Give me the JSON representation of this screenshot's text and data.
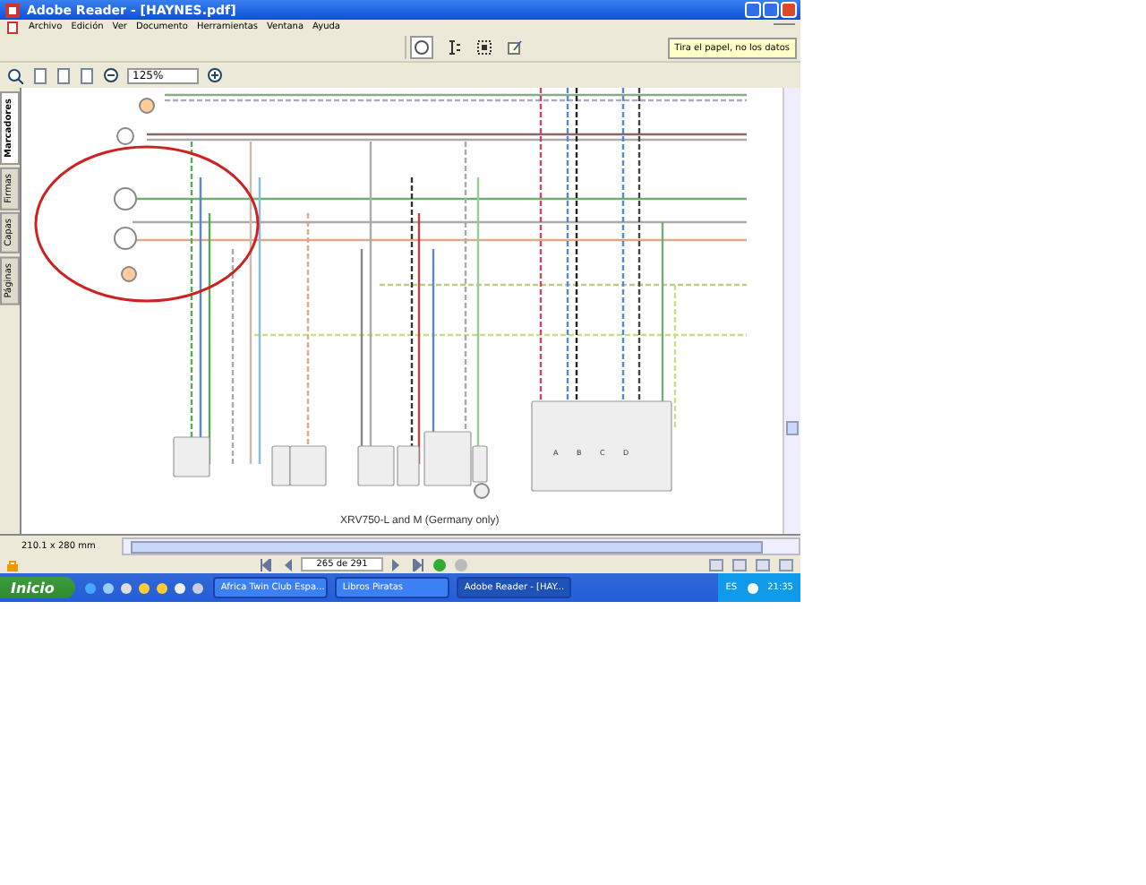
{
  "window": {
    "title": "Adobe Reader - [HAYNES.pdf]"
  },
  "menu": [
    "Archivo",
    "Edición",
    "Ver",
    "Documento",
    "Herramientas",
    "Ventana",
    "Ayuda"
  ],
  "tip": "Tira el papel, no los datos",
  "zoom": "125%",
  "side_tabs": [
    {
      "label": "Marcadores",
      "selected": true
    },
    {
      "label": "Firmas",
      "selected": false
    },
    {
      "label": "Capas",
      "selected": false
    },
    {
      "label": "Páginas",
      "selected": false
    }
  ],
  "document": {
    "caption": "XRV750-L and M (Germany only)",
    "fuse_columns": [
      "A",
      "B",
      "C",
      "D"
    ]
  },
  "page_size": "210.1 x 280 mm",
  "page": "265 de 291",
  "taskbar": {
    "start": "Inicio",
    "tasks": [
      {
        "label": "Africa Twin Club Espa...",
        "selected": false
      },
      {
        "label": "Libros Piratas",
        "selected": false
      },
      {
        "label": "Adobe Reader - [HAY...",
        "selected": true
      }
    ],
    "language": "ES",
    "clock": "21:35"
  }
}
